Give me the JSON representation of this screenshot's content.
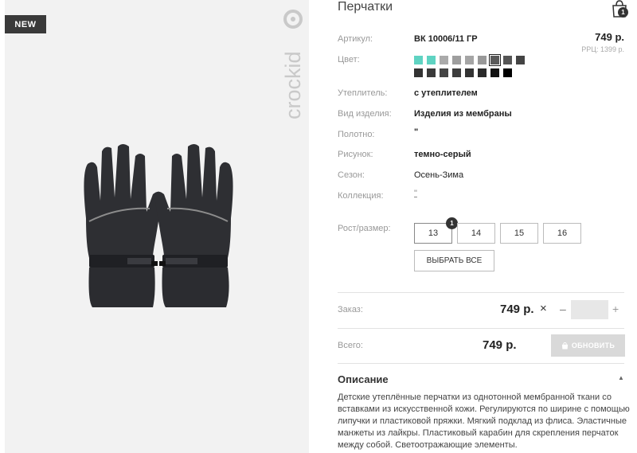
{
  "badge": "NEW",
  "brand": "crockid",
  "product": {
    "title": "Перчатки",
    "price": "749 р.",
    "rrp": "РРЦ: 1399 р.",
    "cart_count": "1"
  },
  "specs": [
    {
      "label": "Артикул:",
      "value": "ВК 10006/11 ГР"
    },
    {
      "label": "Цвет:",
      "value": ""
    },
    {
      "label": "Утеплитель:",
      "value": "с утеплителем"
    },
    {
      "label": "Вид изделия:",
      "value": "Изделия из мембраны"
    },
    {
      "label": "Полотно:",
      "value": "\""
    },
    {
      "label": "Рисунок:",
      "value": "темно-серый"
    },
    {
      "label": "Сезон:",
      "value": "Осень-Зима"
    },
    {
      "label": "Коллекция:",
      "value": "\""
    },
    {
      "label": "Рост/размер:",
      "value": ""
    }
  ],
  "swatch_colors": [
    "#5fd3c2",
    "#5fd3c2",
    "#aaaaaa",
    "#9e9e9e",
    "#a5a5a5",
    "#999999",
    "#5a5a5a",
    "#555555",
    "#444444",
    "#333333",
    "#3a3a3a",
    "#444444",
    "#3d3d3d",
    "#333333",
    "#2a2a2a",
    "#111111",
    "#000000"
  ],
  "selected_swatch_index": 6,
  "sizes": [
    "13",
    "14",
    "15",
    "16"
  ],
  "selected_size_count": "1",
  "select_all_label": "ВЫБРАТЬ ВСЕ",
  "order": {
    "label": "Заказ:",
    "price": "749 р.",
    "times": "×",
    "minus": "–",
    "plus": "+",
    "qty": ""
  },
  "total": {
    "label": "Всего:",
    "price": "749 р.",
    "button": "ОБНОВИТЬ"
  },
  "description": {
    "title": "Описание",
    "text": "Детские утеплённые перчатки из однотонной мембранной ткани со вставками из искусственной кожи. Регулируются по ширине с помощью липучки и пластиковой пряжки. Мягкий подклад из флиса. Эластичные манжеты из лайкры. Пластиковый карабин для скрепления перчаток между собой. Светоотражающие элементы."
  },
  "colors": {
    "badge_bg": "#3a3a3a",
    "accent_mint": "#5fd3c2",
    "button_disabled": "#d9d9d9"
  },
  "icons": [
    "cart-icon",
    "close-icon",
    "chevron-up-icon",
    "bag-icon"
  ]
}
